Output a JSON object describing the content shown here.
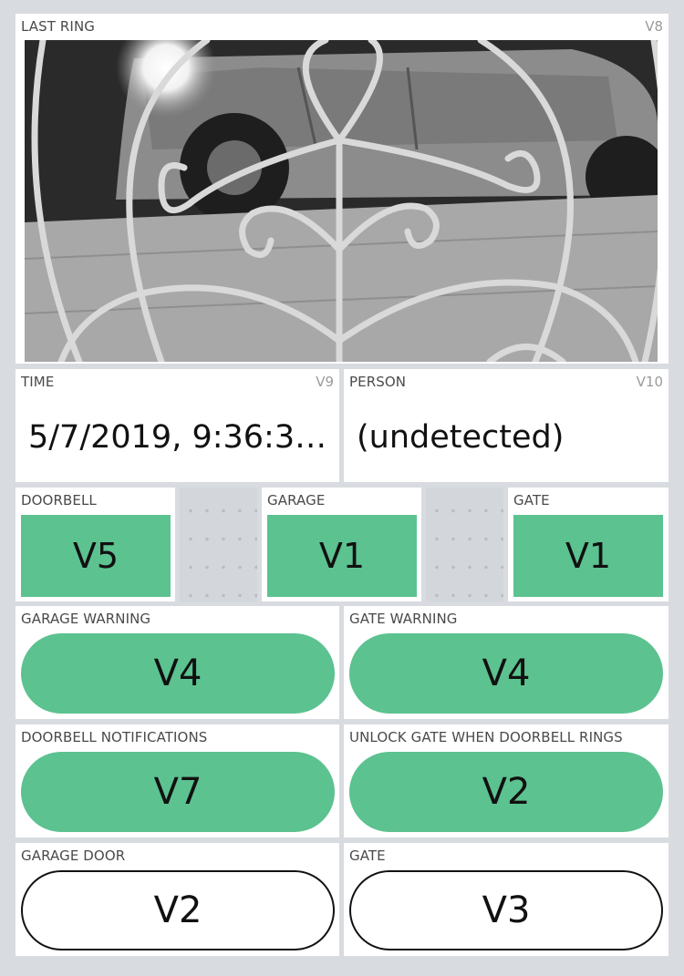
{
  "last_ring": {
    "label": "LAST RING",
    "pin": "V8"
  },
  "time": {
    "label": "TIME",
    "pin": "V9",
    "value": "5/7/2019, 9:36:3…"
  },
  "person": {
    "label": "PERSON",
    "pin": "V10",
    "value": "(undetected)"
  },
  "leds": [
    {
      "label": "DOORBELL",
      "value": "V5"
    },
    {
      "label": "GARAGE",
      "value": "V1"
    },
    {
      "label": "GATE",
      "value": "V1"
    }
  ],
  "switches": [
    {
      "label": "GARAGE WARNING",
      "value": "V4",
      "state": "on"
    },
    {
      "label": "GATE WARNING",
      "value": "V4",
      "state": "on"
    },
    {
      "label": "DOORBELL NOTIFICATIONS",
      "value": "V7",
      "state": "on"
    },
    {
      "label": "UNLOCK GATE WHEN DOORBELL RINGS",
      "value": "V2",
      "state": "on"
    },
    {
      "label": "GARAGE DOOR",
      "value": "V2",
      "state": "off"
    },
    {
      "label": "GATE",
      "value": "V3",
      "state": "off"
    }
  ],
  "colors": {
    "background": "#d8dbdf",
    "accent": "#5cc290",
    "tile": "#ffffff"
  }
}
